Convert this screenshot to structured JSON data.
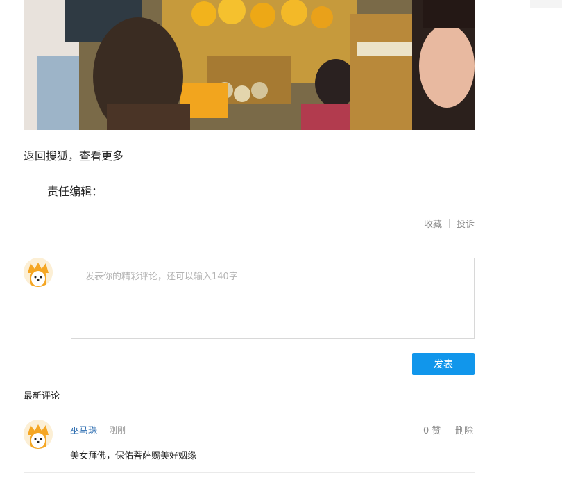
{
  "article": {
    "image_alt": "",
    "back_link": "返回搜狐，查看更多",
    "editor_label": "责任编辑："
  },
  "actions": {
    "favorite": "收藏",
    "report": "投诉"
  },
  "comment_form": {
    "placeholder": "发表你的精彩评论，还可以输入140字",
    "submit_label": "发表"
  },
  "latest": {
    "title": "最新评论",
    "comments": [
      {
        "user": "巫马珠",
        "time": "刚刚",
        "likes": "0 赞",
        "delete_label": "删除",
        "text": "美女拜佛，保佑菩萨赐美好姻缘"
      }
    ]
  },
  "colors": {
    "accent": "#1196eb",
    "username": "#2b6cb0"
  },
  "icons": {
    "avatar": "fox-avatar-icon"
  }
}
